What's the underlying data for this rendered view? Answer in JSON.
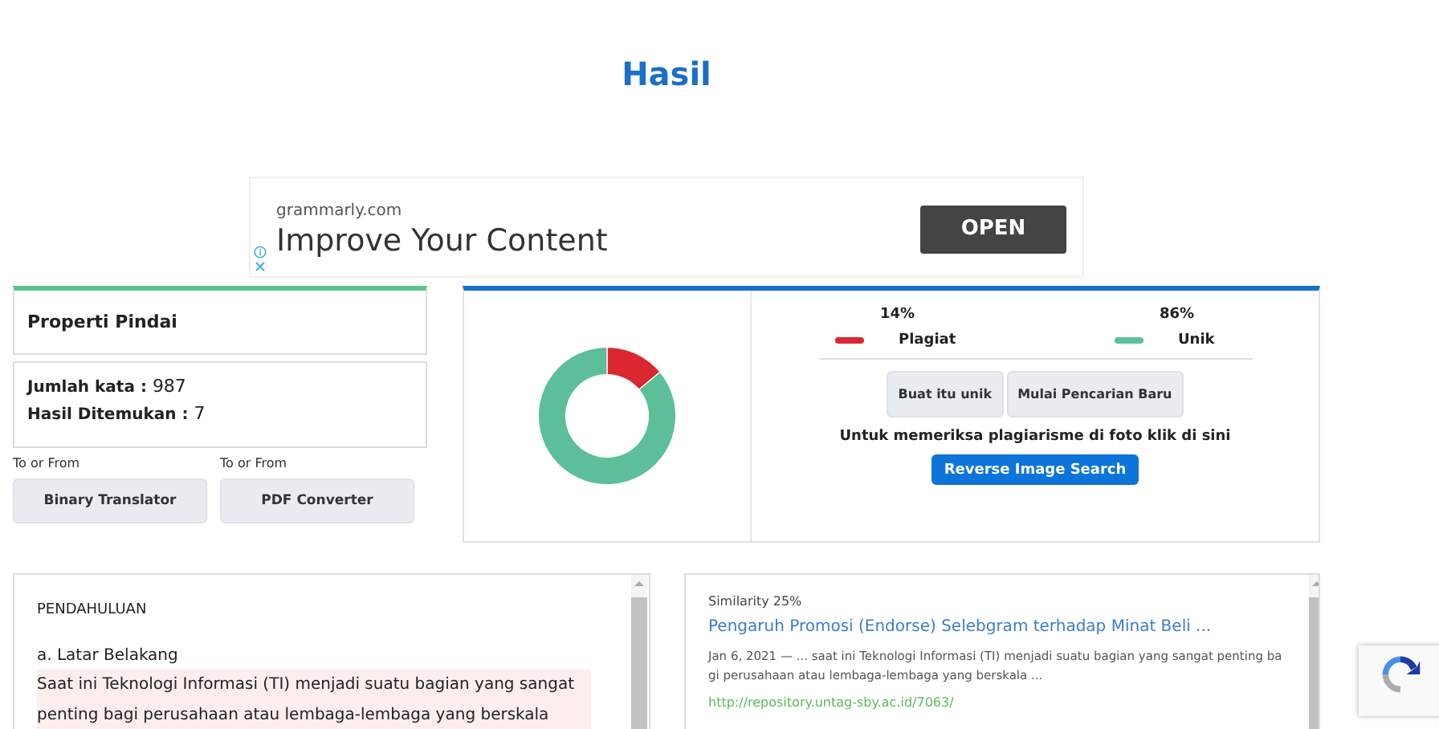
{
  "header": {
    "title": "Hasil"
  },
  "ad": {
    "domain": "grammarly.com",
    "headline": "Improve Your Content",
    "button": "OPEN"
  },
  "scan_properties": {
    "title": "Properti Pindai",
    "stats": [
      {
        "label": "Jumlah kata :",
        "value": "987"
      },
      {
        "label": "Hasil Ditemukan :",
        "value": "7"
      }
    ]
  },
  "tools": [
    {
      "caption": "To or From",
      "button": "Binary Translator"
    },
    {
      "caption": "To or From",
      "button": "PDF Converter"
    }
  ],
  "result": {
    "chart_data": {
      "type": "donut",
      "categories": [
        "Plagiat",
        "Unik"
      ],
      "values": [
        14,
        86
      ]
    },
    "legend": [
      {
        "percent": "14%",
        "color": "#d9282f"
      },
      {
        "percent": "86%",
        "color": "#5dbf9a"
      }
    ],
    "buttons": [
      "Buat itu unik",
      "Mulai Pencarian Baru"
    ],
    "image_hint": "Untuk memeriksa plagiarisme di foto klik di sini",
    "image_button": "Reverse Image Search"
  },
  "document": {
    "heading": "PENDAHULUAN",
    "subheading": "a. Latar Belakang",
    "paragraphs": [
      {
        "text": "Saat ini Teknologi Informasi (TI) menjadi suatu bagian yang sangat penting bagi perusahaan atau lembaga-lembaga yang berskala",
        "highlighted": true
      }
    ]
  },
  "matches": [
    {
      "similarity": "Similarity 25%",
      "title": "Pengaruh Promosi (Endorse) Selebgram terhadap Minat Beli ...",
      "snippet": "Jan 6, 2021 — ... saat ini Teknologi Informasi (TI) menjadi suatu bagian yang sangat penting bagi perusahaan atau lembaga-lembaga yang berskala ...",
      "url": "http://repository.untag-sby.ac.id/7063/"
    }
  ]
}
